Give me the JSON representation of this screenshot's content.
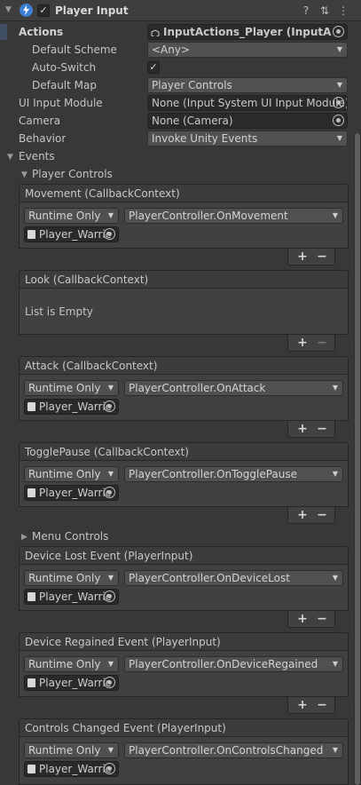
{
  "component": {
    "title": "Player Input",
    "enabled_check": "✓",
    "help_icon": "?",
    "presets_icon": "⇅",
    "menu_icon": "⋮"
  },
  "props": {
    "actions": {
      "label": "Actions",
      "value": "InputActions_Player (InputA"
    },
    "default_scheme": {
      "label": "Default Scheme",
      "value": "<Any>"
    },
    "auto_switch": {
      "label": "Auto-Switch",
      "check": "✓"
    },
    "default_map": {
      "label": "Default Map",
      "value": "Player Controls"
    },
    "ui_input_module": {
      "label": "UI Input Module",
      "value": "None (Input System UI Input Module)"
    },
    "camera": {
      "label": "Camera",
      "value": "None (Camera)"
    },
    "behavior": {
      "label": "Behavior",
      "value": "Invoke Unity Events"
    }
  },
  "events": {
    "label": "Events",
    "player_controls_label": "Player Controls",
    "menu_controls_label": "Menu Controls"
  },
  "panels": {
    "movement": {
      "header": "Movement (CallbackContext)",
      "runtime": "Runtime Only",
      "target": "Player_Warric",
      "func": "PlayerController.OnMovement"
    },
    "look": {
      "header": "Look (CallbackContext)",
      "empty": "List is Empty"
    },
    "attack": {
      "header": "Attack (CallbackContext)",
      "runtime": "Runtime Only",
      "target": "Player_Warric",
      "func": "PlayerController.OnAttack"
    },
    "toggle": {
      "header": "TogglePause (CallbackContext)",
      "runtime": "Runtime Only",
      "target": "Player_Warric",
      "func": "PlayerController.OnTogglePause"
    },
    "lost": {
      "header": "Device Lost Event (PlayerInput)",
      "runtime": "Runtime Only",
      "target": "Player_Warric",
      "func": "PlayerController.OnDeviceLost"
    },
    "regained": {
      "header": "Device Regained Event (PlayerInput)",
      "runtime": "Runtime Only",
      "target": "Player_Warric",
      "func": "PlayerController.OnDeviceRegained"
    },
    "changed": {
      "header": "Controls Changed Event (PlayerInput)",
      "runtime": "Runtime Only",
      "target": "Player_Warric",
      "func": "PlayerController.OnControlsChanged"
    }
  },
  "buttons": {
    "plus": "+",
    "minus": "−"
  }
}
